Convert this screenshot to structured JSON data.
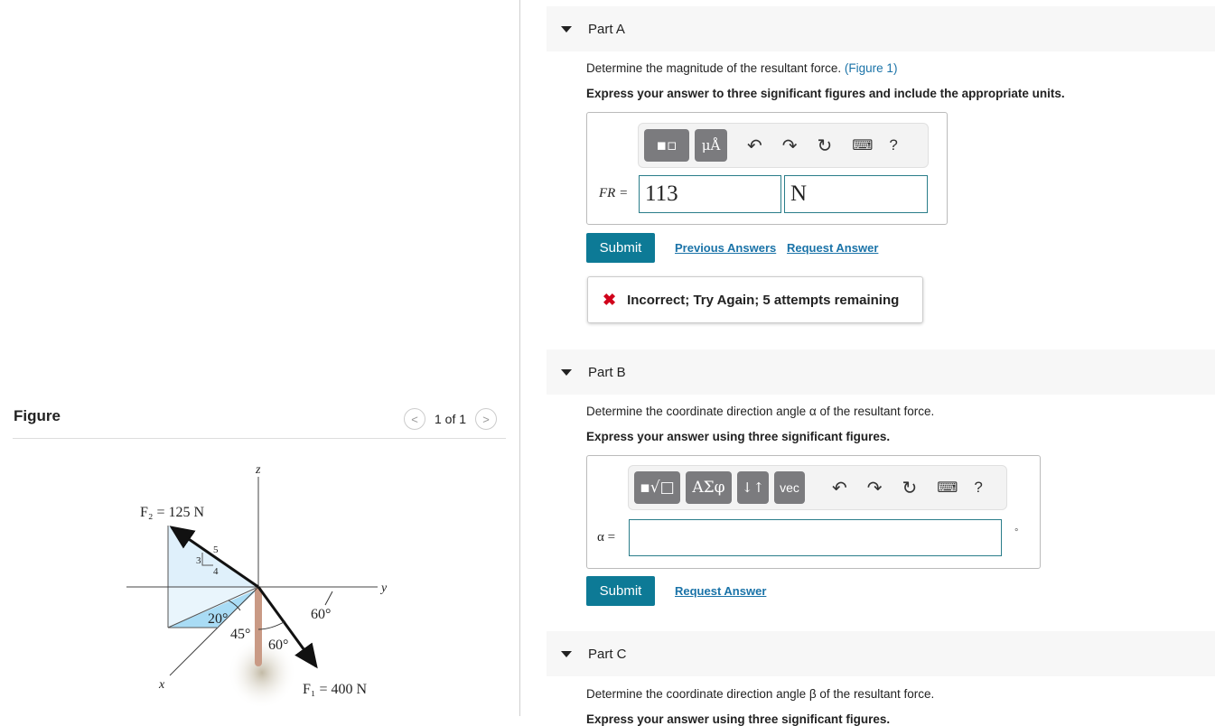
{
  "figure": {
    "title": "Figure",
    "pager": "1 of 1",
    "prev": "<",
    "next": ">",
    "labels": {
      "z": "z",
      "y": "y",
      "x": "x",
      "f2": "F₂ = 125 N",
      "f1": "F₁ = 400 N",
      "n3": "3",
      "n4": "4",
      "n5": "5",
      "a20": "20°",
      "a45": "45°",
      "a60a": "60°",
      "a60b": "60°"
    }
  },
  "partA": {
    "title": "Part A",
    "question": "Determine the magnitude of the resultant force.",
    "figure_link": "(Figure 1)",
    "instruction": "Express your answer to three significant figures and include the appropriate units.",
    "tool_units": "μÅ",
    "help": "?",
    "label": "FR =",
    "value": "113",
    "unit": "N",
    "submit": "Submit",
    "previous": "Previous Answers",
    "request": "Request Answer",
    "feedback": "Incorrect; Try Again; 5 attempts remaining",
    "feedback_icon": "✖",
    "feedback_color": "#d0021b"
  },
  "partB": {
    "title": "Part B",
    "question": "Determine the coordinate direction angle α of the resultant force.",
    "instruction": "Express your answer using three significant figures.",
    "tool_greek": "ΑΣφ",
    "tool_arrows": "↓↑",
    "tool_vec": "vec",
    "help": "?",
    "label": "α =",
    "value": "",
    "unit": "°",
    "submit": "Submit",
    "request": "Request Answer"
  },
  "partC": {
    "title": "Part C",
    "question": "Determine the coordinate direction angle β of the resultant force.",
    "instruction": "Express your answer using three significant figures."
  }
}
